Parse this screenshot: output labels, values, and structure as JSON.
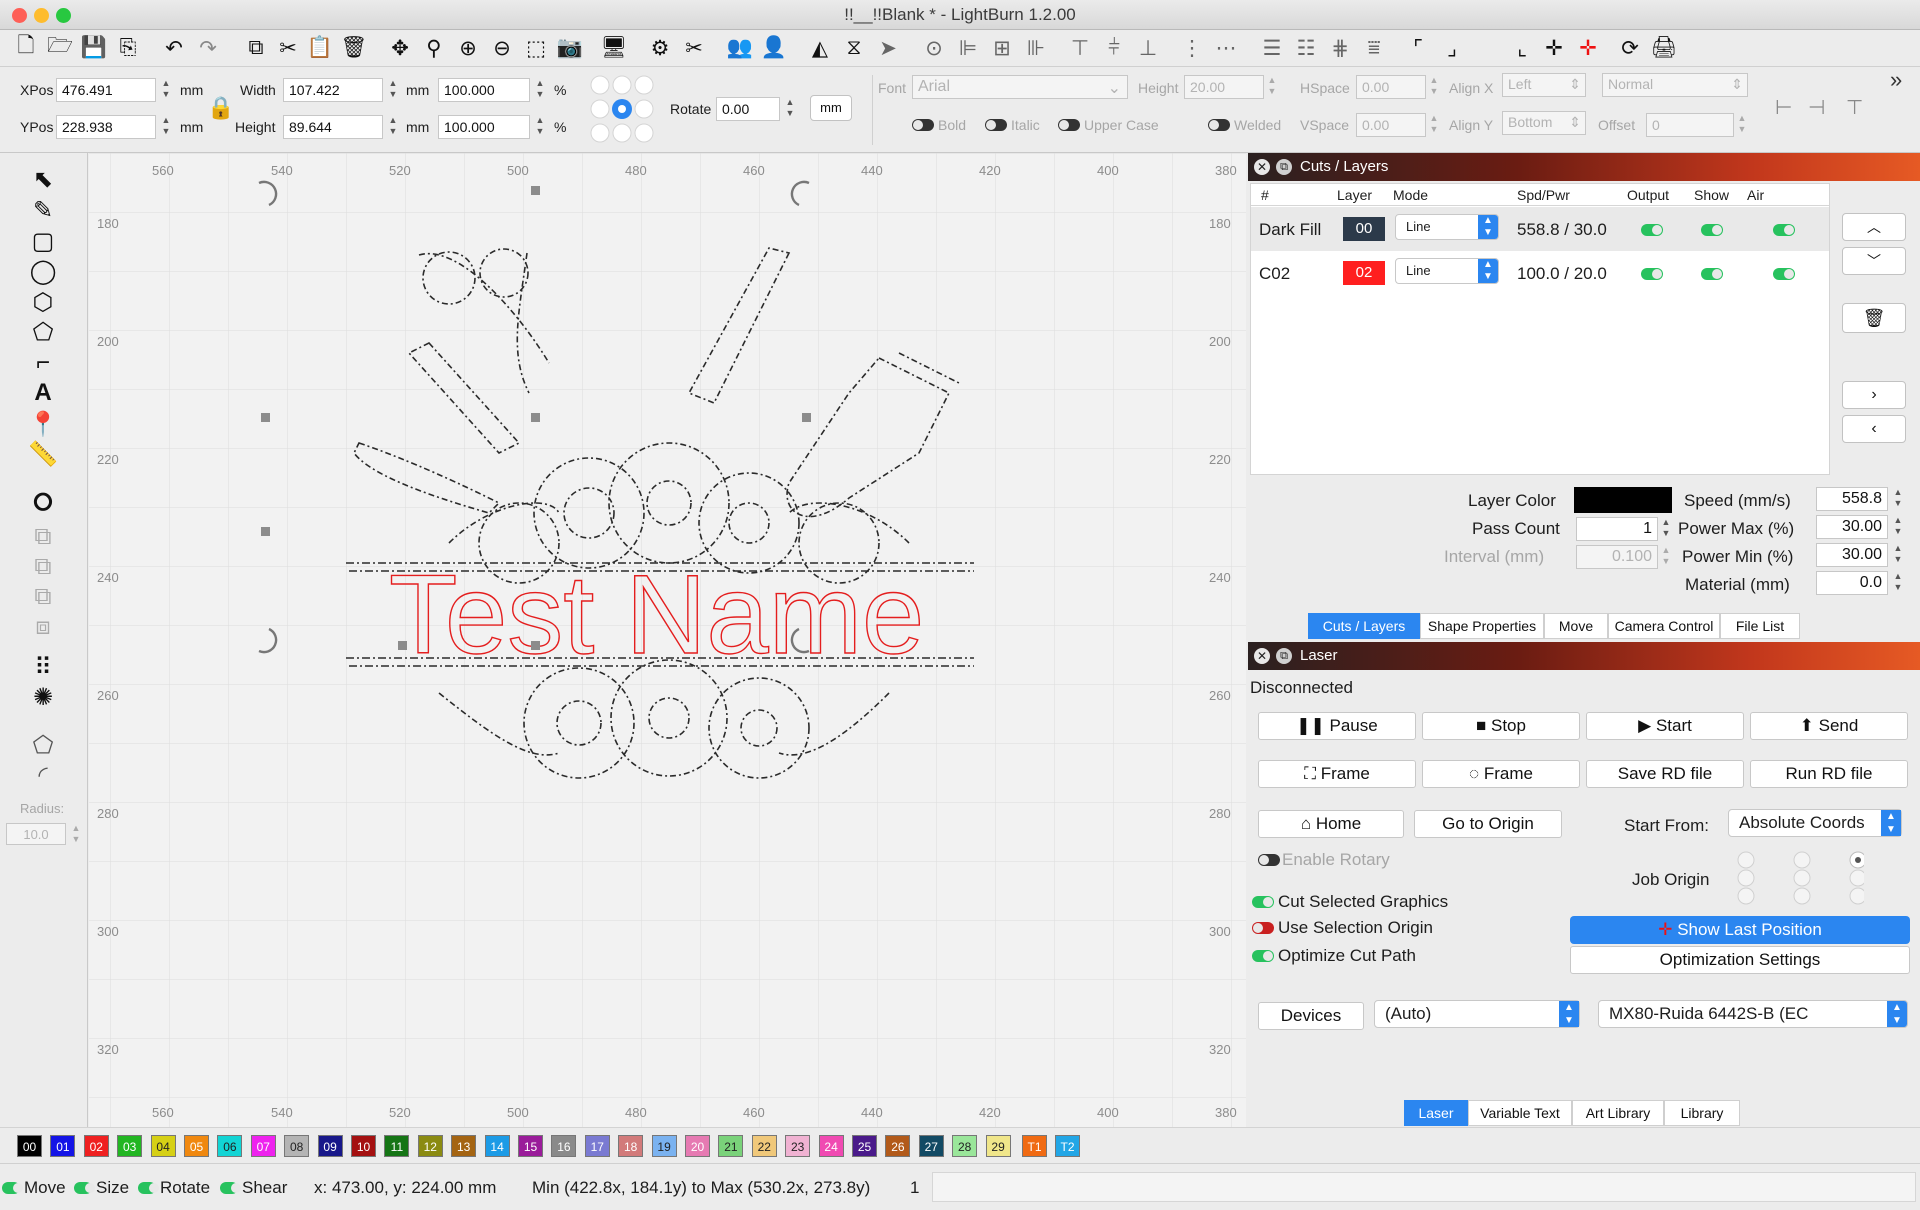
{
  "window": {
    "title": "!!__!!Blank * - LightBurn 1.2.00"
  },
  "toolbar": {
    "icons": [
      "new-file-icon",
      "open-file-icon",
      "save-icon",
      "save-as-icon",
      "undo-icon",
      "redo-icon",
      "copy-icon",
      "cut-icon",
      "paste-icon",
      "delete-icon",
      "move-icon",
      "zoom-icon",
      "zoom-in-icon",
      "zoom-out-icon",
      "zoom-frame-icon",
      "camera-capture-icon",
      "monitor-icon",
      "settings-icon",
      "tools-icon",
      "users-icon",
      "user-icon",
      "flip-h-icon",
      "mirror-icon",
      "send-icon",
      "center-icon",
      "align-left-icon",
      "align-center-icon",
      "align-right-icon",
      "align-top-icon",
      "align-middle-icon",
      "align-bottom-icon",
      "distribute-h-icon",
      "distribute-v-icon",
      "space-h-icon",
      "space-v-icon",
      "space-equal-h-icon",
      "space-equal-v-icon",
      "corner-tl-icon",
      "corner-br-icon",
      "corner-bl-icon",
      "crosshair-icon",
      "red-crosshair-icon",
      "refresh-icon",
      "machine-icon"
    ]
  },
  "props": {
    "xpos_label": "XPos",
    "xpos": "476.491",
    "ypos_label": "YPos",
    "ypos": "228.938",
    "width_label": "Width",
    "width": "107.422",
    "height_label": "Height",
    "height": "89.644",
    "scale_w": "100.000",
    "scale_h": "100.000",
    "unit": "mm",
    "pct": "%",
    "rotate_label": "Rotate",
    "rotate": "0.00",
    "mm_button": "mm",
    "font_label": "Font",
    "font_value": "Arial",
    "text_height_label": "Height",
    "text_height": "20.00",
    "hspace_label": "HSpace",
    "hspace": "0.00",
    "vspace_label": "VSpace",
    "vspace": "0.00",
    "alignx_label": "Align X",
    "alignx": "Left",
    "aligny_label": "Align Y",
    "aligny": "Bottom",
    "normal": "Normal",
    "offset_label": "Offset",
    "offset": "0",
    "bold": "Bold",
    "italic": "Italic",
    "upper": "Upper Case",
    "welded": "Welded"
  },
  "tools": {
    "radius_label": "Radius:",
    "radius": "10.0"
  },
  "canvas": {
    "x_ticks": [
      "560",
      "540",
      "520",
      "500",
      "480",
      "460",
      "440",
      "420",
      "400",
      "380"
    ],
    "y_ticks": [
      "180",
      "200",
      "220",
      "240",
      "260",
      "280",
      "300",
      "320"
    ],
    "design_text": "Test Name"
  },
  "cuts": {
    "title": "Cuts / Layers",
    "headers": {
      "num": "#",
      "layer": "Layer",
      "mode": "Mode",
      "spdpwr": "Spd/Pwr",
      "output": "Output",
      "show": "Show",
      "air": "Air"
    },
    "rows": [
      {
        "name": "Dark Fill",
        "layer": "00",
        "mode": "Line",
        "spdpwr": "558.8 / 30.0",
        "color": "#222222"
      },
      {
        "name": "C02",
        "layer": "02",
        "mode": "Line",
        "spdpwr": "100.0 / 20.0",
        "color": "#ff1f1f"
      }
    ],
    "layer_color_label": "Layer Color",
    "pass_count_label": "Pass Count",
    "pass_count": "1",
    "interval_label": "Interval (mm)",
    "interval": "0.100",
    "speed_label": "Speed (mm/s)",
    "speed": "558.8",
    "power_max_label": "Power Max (%)",
    "power_max": "30.00",
    "power_min_label": "Power Min (%)",
    "power_min": "30.00",
    "material_label": "Material (mm)",
    "material": "0.0",
    "tabs": [
      "Cuts / Layers",
      "Shape Properties",
      "Move",
      "Camera Control",
      "File List"
    ]
  },
  "laser": {
    "title": "Laser",
    "status": "Disconnected",
    "pause": "Pause",
    "stop": "Stop",
    "start": "Start",
    "send": "Send",
    "frame1": "Frame",
    "frame2": "Frame",
    "save_rd": "Save RD file",
    "run_rd": "Run RD file",
    "home": "Home",
    "go_origin": "Go to Origin",
    "start_from_label": "Start From:",
    "start_from": "Absolute Coords",
    "enable_rotary": "Enable Rotary",
    "job_origin": "Job Origin",
    "cut_selected": "Cut Selected Graphics",
    "use_selection_origin": "Use Selection Origin",
    "optimize_cut": "Optimize Cut Path",
    "show_last": "Show Last Position",
    "opt_settings": "Optimization Settings",
    "devices": "Devices",
    "device_port": "(Auto)",
    "device_name": "MX80-Ruida 6442S-B (EC",
    "tabs": [
      "Laser",
      "Variable Text",
      "Art Library",
      "Library"
    ]
  },
  "palette": [
    {
      "l": "00",
      "c": "#000000"
    },
    {
      "l": "01",
      "c": "#1414e6"
    },
    {
      "l": "02",
      "c": "#ef2020"
    },
    {
      "l": "03",
      "c": "#22b622"
    },
    {
      "l": "04",
      "c": "#d6d015"
    },
    {
      "l": "05",
      "c": "#f0880f"
    },
    {
      "l": "06",
      "c": "#12d4d4"
    },
    {
      "l": "07",
      "c": "#ee22ee"
    },
    {
      "l": "08",
      "c": "#b4b4b4"
    },
    {
      "l": "09",
      "c": "#18188a"
    },
    {
      "l": "10",
      "c": "#a41010"
    },
    {
      "l": "11",
      "c": "#157515"
    },
    {
      "l": "12",
      "c": "#8b8b12"
    },
    {
      "l": "13",
      "c": "#a46412"
    },
    {
      "l": "14",
      "c": "#1c9be6"
    },
    {
      "l": "15",
      "c": "#9a1c9a"
    },
    {
      "l": "16",
      "c": "#8a8a8a"
    },
    {
      "l": "17",
      "c": "#7a7ad2"
    },
    {
      "l": "18",
      "c": "#d27a7a"
    },
    {
      "l": "19",
      "c": "#7ab2f0"
    },
    {
      "l": "20",
      "c": "#e67ab2"
    },
    {
      "l": "21",
      "c": "#7ad27a"
    },
    {
      "l": "22",
      "c": "#f0c87a"
    },
    {
      "l": "23",
      "c": "#f0b2d2"
    },
    {
      "l": "24",
      "c": "#f04ab2"
    },
    {
      "l": "25",
      "c": "#4a1a8a"
    },
    {
      "l": "26",
      "c": "#b25a1a"
    },
    {
      "l": "27",
      "c": "#124a64"
    },
    {
      "l": "28",
      "c": "#9ae69a"
    },
    {
      "l": "29",
      "c": "#f0e68a"
    },
    {
      "l": "T1",
      "c": "#f06a12"
    },
    {
      "l": "T2",
      "c": "#22a6e6"
    }
  ],
  "status": {
    "move": "Move",
    "size": "Size",
    "rotate": "Rotate",
    "shear": "Shear",
    "coords": "x: 473.00, y: 224.00 mm",
    "bounds": "Min (422.8x, 184.1y) to Max (530.2x, 273.8y)",
    "count": "1"
  }
}
